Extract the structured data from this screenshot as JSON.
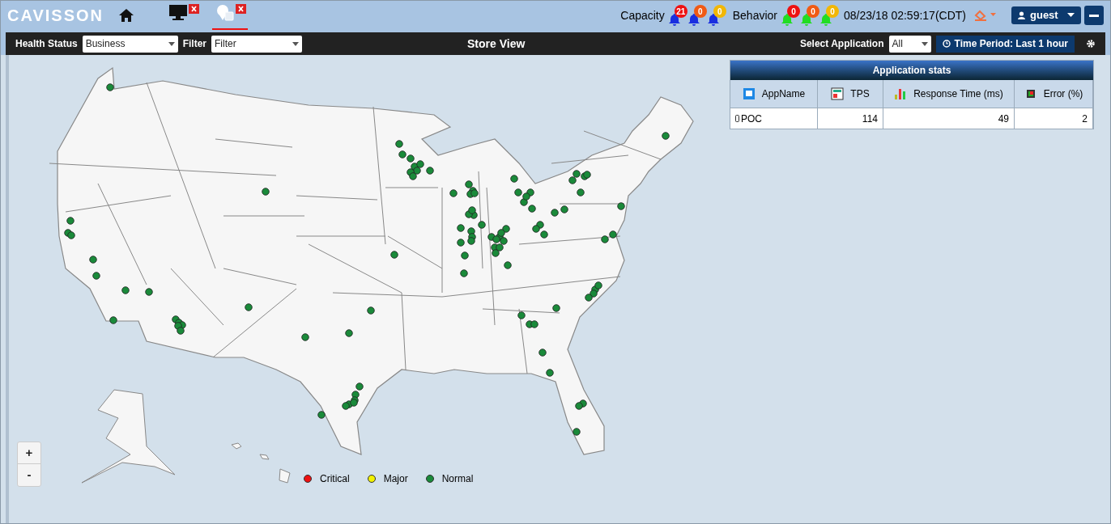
{
  "header": {
    "logo": "CAVISSON",
    "nav_tabs": [
      {
        "kind": "monitor",
        "selected": false
      },
      {
        "kind": "store",
        "selected": true
      }
    ],
    "capacity": {
      "label": "Capacity",
      "alerts": [
        {
          "count": "21",
          "color": "#ee1111"
        },
        {
          "count": "0",
          "color": "#f05a14"
        },
        {
          "count": "0",
          "color": "#f2b705"
        }
      ]
    },
    "behavior": {
      "label": "Behavior",
      "alerts": [
        {
          "count": "0",
          "color": "#ee1111"
        },
        {
          "count": "0",
          "color": "#f05a14"
        },
        {
          "count": "0",
          "color": "#f2b705"
        }
      ]
    },
    "datetime": "08/23/18 02:59:17(CDT)",
    "user": "guest"
  },
  "toolbar": {
    "health_status": {
      "label": "Health Status",
      "value": "Business"
    },
    "filter": {
      "label": "Filter",
      "value": "Filter"
    },
    "title": "Store View",
    "select_application": {
      "label": "Select Application",
      "value": "All"
    },
    "time_period": "Time Period: Last 1 hour"
  },
  "app_stats": {
    "title": "Application stats",
    "columns": [
      "AppName",
      "TPS",
      "Response Time (ms)",
      "Error (%)"
    ],
    "rows": [
      [
        "POC",
        "114",
        "49",
        "2"
      ]
    ]
  },
  "map": {
    "zoom_in": "+",
    "zoom_out": "-"
  },
  "legend": [
    {
      "label": "Critical",
      "color": "#ee1111"
    },
    {
      "label": "Major",
      "color": "#f2f200"
    },
    {
      "label": "Normal",
      "color": "#1a8a3a"
    }
  ]
}
